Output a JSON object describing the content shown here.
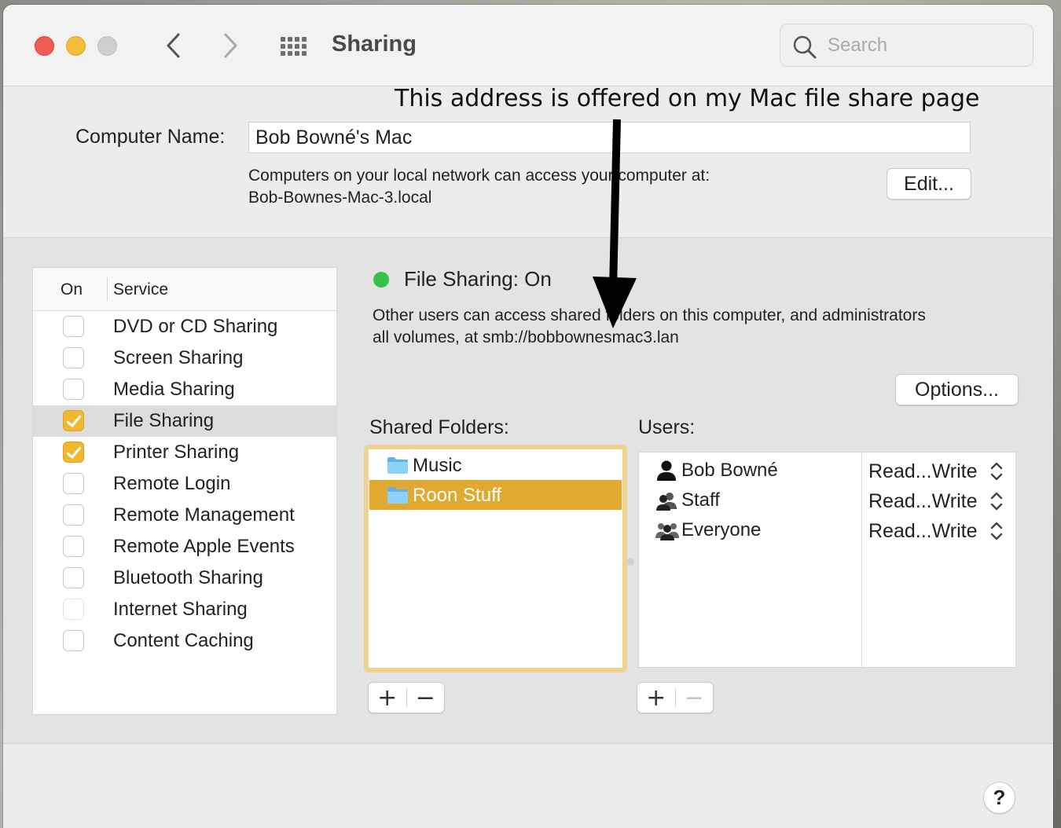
{
  "window": {
    "title": "Sharing",
    "search": {
      "placeholder": "Search",
      "value": ""
    }
  },
  "annotation": "This address is offered on my Mac file share page",
  "computer_name": {
    "label": "Computer Name:",
    "value": "Bob Bowné's Mac",
    "local_line1": "Computers on your local network can access your computer at:",
    "local_line2": "Bob-Bownes-Mac-3.local",
    "edit_label": "Edit..."
  },
  "services": {
    "header_on": "On",
    "header_service": "Service",
    "items": [
      {
        "label": "DVD or CD Sharing",
        "checked": false
      },
      {
        "label": "Screen Sharing",
        "checked": false
      },
      {
        "label": "Media Sharing",
        "checked": false
      },
      {
        "label": "File Sharing",
        "checked": true,
        "selected": true
      },
      {
        "label": "Printer Sharing",
        "checked": true
      },
      {
        "label": "Remote Login",
        "checked": false
      },
      {
        "label": "Remote Management",
        "checked": false
      },
      {
        "label": "Remote Apple Events",
        "checked": false
      },
      {
        "label": "Bluetooth Sharing",
        "checked": false
      },
      {
        "label": "Internet Sharing",
        "checked": false,
        "disabled": true
      },
      {
        "label": "Content Caching",
        "checked": false
      }
    ]
  },
  "file_sharing": {
    "status": "File Sharing: On",
    "status_color": "#34c24a",
    "desc_line1": "Other users can access shared folders on this computer, and administrators",
    "desc_line2": "all volumes, at smb://bobbownesmac3.lan",
    "options_label": "Options...",
    "shared_folders_label": "Shared Folders:",
    "users_label": "Users:",
    "folders": [
      {
        "name": "Music",
        "selected": false
      },
      {
        "name": "Roon Stuff",
        "selected": true
      }
    ],
    "users": [
      {
        "name": "Bob Bowné",
        "permission": "Read...Write",
        "icon": "person-icon"
      },
      {
        "name": "Staff",
        "permission": "Read...Write",
        "icon": "group-icon"
      },
      {
        "name": "Everyone",
        "permission": "Read...Write",
        "icon": "everyone-icon"
      }
    ],
    "add_symbol": "+",
    "remove_symbol": "−"
  },
  "help_label": "?",
  "colors": {
    "accent": "#f0b730",
    "selection": "#e1a92f",
    "focus_ring": "#efd291"
  }
}
